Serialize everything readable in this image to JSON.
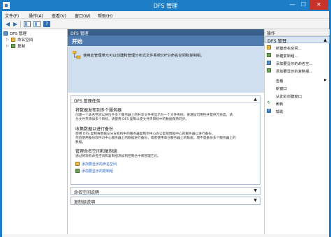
{
  "window": {
    "title": "DFS 管理",
    "min_glyph": "—",
    "max_glyph": "☐",
    "close_glyph": "✕"
  },
  "menu": [
    "文件(F)",
    "操作(A)",
    "查看(V)",
    "窗口(W)",
    "帮助(H)"
  ],
  "toolbar": {
    "back_glyph": "◀",
    "forward_glyph": "▶",
    "help_glyph": "?"
  },
  "tree": {
    "root": "DFS 管理",
    "children": [
      "命名空间",
      "复制"
    ]
  },
  "center": {
    "header": "DFS 管理",
    "banner_title": "开始",
    "banner_text": "使用此管理单元可以创建和管理分布式文件系统(DFS)命名空间和复制组。",
    "tasks_title": "DFS 管理任务",
    "task1_title": "将数据发布到多个服务器",
    "task1_text_1": "创建一个命名空间以将位于多个服务器上的共享文件夹显示为一个文件夹树。要增加可用性并提供冗余度，请",
    "task1_text_2": "为文件夹添加多个目标，请使用 DFS 复制以使文件夹目标中的数据保持同步。",
    "task2_title": "收集数据以进行备份",
    "task2_text_1": "使用 DFS 复制将数据从分支机构中的服务器复制到中心办公室或数据中心的服务器以进行备份。",
    "task2_text_2": "然后使用备份软件对中心服务器上的数据进行备份，或者使用单台服务器上的数据，而不是备份多个服务器上的",
    "task2_text_3": "数据。",
    "task3_title": "管理命名空间和复制组",
    "task3_text": "通过将现有命名空间和复制组添加到控制台中来管理它们。",
    "link_ns": "添加要显示的命名空间",
    "link_rep": "添加要显示的复制组",
    "ns_section": "命名空间说明",
    "rep_section": "复制组说明",
    "expand_arrow": "▲",
    "collapse_arrow": "▼"
  },
  "actions": {
    "header": "操作",
    "group": "DFS 管理",
    "group_arrow": "▲",
    "items": [
      "新建命名空间...",
      "新建复制组...",
      "添加要显示的命名空...",
      "添加要显示的复制组...",
      "查看",
      "新窗口",
      "从此处创建窗口",
      "刷新",
      "帮助"
    ],
    "submenu_arrow": "▶"
  },
  "icons": {
    "refresh_glyph": "↻",
    "help_glyph": "?"
  }
}
